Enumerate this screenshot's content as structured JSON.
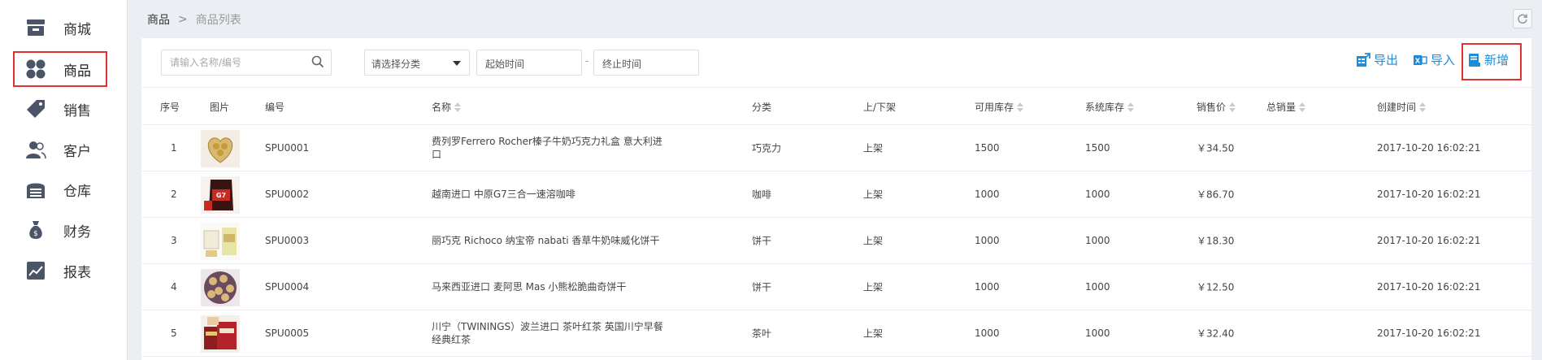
{
  "sidebar": {
    "items": [
      {
        "label": "商城",
        "icon": "store-icon"
      },
      {
        "label": "商品",
        "icon": "product-icon",
        "active": true
      },
      {
        "label": "销售",
        "icon": "tag-icon"
      },
      {
        "label": "客户",
        "icon": "customer-icon"
      },
      {
        "label": "仓库",
        "icon": "warehouse-icon"
      },
      {
        "label": "财务",
        "icon": "money-bag-icon"
      },
      {
        "label": "报表",
        "icon": "chart-icon"
      }
    ]
  },
  "breadcrumb": {
    "root": "商品",
    "separator": ">",
    "current": "商品列表"
  },
  "filters": {
    "search_placeholder": "请输入名称/编号",
    "category_placeholder": "请选择分类",
    "start_date_placeholder": "起始时间",
    "date_separator": "-",
    "end_date_placeholder": "终止时间"
  },
  "actions": {
    "export": "导出",
    "import": "导入",
    "add": "新增"
  },
  "table": {
    "columns": {
      "index": "序号",
      "image": "图片",
      "code": "编号",
      "name": "名称",
      "category": "分类",
      "shelf": "上/下架",
      "available_stock": "可用库存",
      "system_stock": "系统库存",
      "price": "销售价",
      "total_sales": "总销量",
      "created": "创建时间"
    },
    "rows": [
      {
        "index": "1",
        "code": "SPU0001",
        "name": "费列罗Ferrero Rocher榛子牛奶巧克力礼盒 意大利进口",
        "category": "巧克力",
        "shelf": "上架",
        "available_stock": "1500",
        "system_stock": "1500",
        "price": "￥34.50",
        "total_sales": "",
        "created": "2017-10-20 16:02:21"
      },
      {
        "index": "2",
        "code": "SPU0002",
        "name": "越南进口 中原G7三合一速溶咖啡",
        "category": "咖啡",
        "shelf": "上架",
        "available_stock": "1000",
        "system_stock": "1000",
        "price": "￥86.70",
        "total_sales": "",
        "created": "2017-10-20 16:02:21"
      },
      {
        "index": "3",
        "code": "SPU0003",
        "name": "丽巧克 Richoco 纳宝帝 nabati 香草牛奶味威化饼干",
        "category": "饼干",
        "shelf": "上架",
        "available_stock": "1000",
        "system_stock": "1000",
        "price": "￥18.30",
        "total_sales": "",
        "created": "2017-10-20 16:02:21"
      },
      {
        "index": "4",
        "code": "SPU0004",
        "name": "马来西亚进口 麦阿思 Mas 小熊松脆曲奇饼干",
        "category": "饼干",
        "shelf": "上架",
        "available_stock": "1000",
        "system_stock": "1000",
        "price": "￥12.50",
        "total_sales": "",
        "created": "2017-10-20 16:02:21"
      },
      {
        "index": "5",
        "code": "SPU0005",
        "name": "川宁（TWININGS）波兰进口 茶叶红茶 英国川宁早餐经典红茶",
        "category": "茶叶",
        "shelf": "上架",
        "available_stock": "1000",
        "system_stock": "1000",
        "price": "￥32.40",
        "total_sales": "",
        "created": "2017-10-20 16:02:21"
      }
    ]
  },
  "colors": {
    "accent": "#1e8cd9",
    "highlight": "#e0322d",
    "icon": "#4a5568"
  }
}
